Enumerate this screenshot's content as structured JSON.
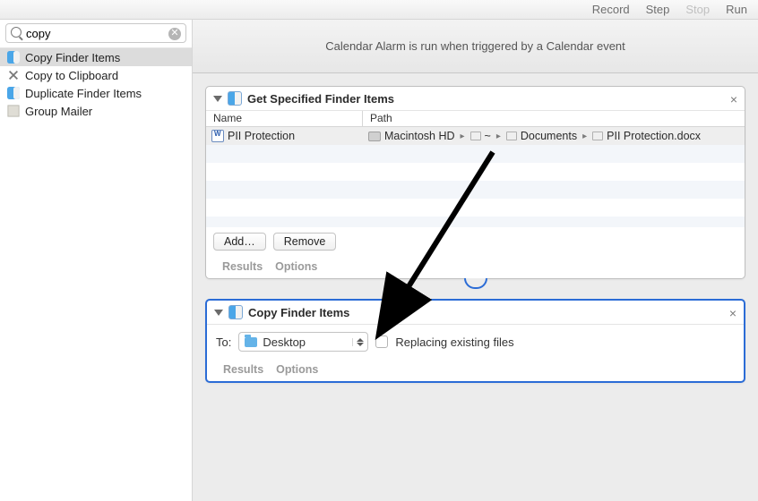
{
  "toolbar": {
    "record": "Record",
    "step": "Step",
    "stop": "Stop",
    "run": "Run"
  },
  "search": {
    "value": "copy"
  },
  "sidebar": {
    "items": [
      {
        "label": "Copy Finder Items"
      },
      {
        "label": "Copy to Clipboard"
      },
      {
        "label": "Duplicate Finder Items"
      },
      {
        "label": "Group Mailer"
      }
    ]
  },
  "banner": "Calendar Alarm is run when triggered by a Calendar event",
  "action1": {
    "title": "Get Specified Finder Items",
    "cols": {
      "name": "Name",
      "path": "Path"
    },
    "row": {
      "name": "PII Protection",
      "hd": "Macintosh HD",
      "home": "~",
      "folder": "Documents",
      "file": "PII Protection.docx"
    },
    "add": "Add…",
    "remove": "Remove",
    "results": "Results",
    "options": "Options"
  },
  "action2": {
    "title": "Copy Finder Items",
    "to": "To:",
    "dest": "Desktop",
    "replace": "Replacing existing files",
    "results": "Results",
    "options": "Options"
  }
}
